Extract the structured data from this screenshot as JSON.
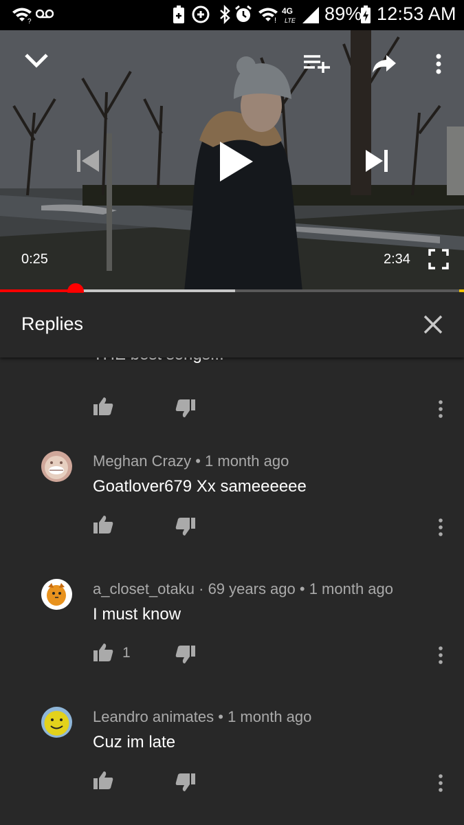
{
  "status_bar": {
    "battery": "89%",
    "time": "12:53 AM",
    "network": "4G LTE",
    "icons": [
      "wifi-icon",
      "voicemail-icon",
      "battery-saver-icon",
      "data-saver-icon",
      "bluetooth-icon",
      "alarm-icon",
      "wifi-signal-icon",
      "network-4g-icon",
      "cell-signal-icon",
      "battery-icon"
    ]
  },
  "player": {
    "current_time": "0:25",
    "duration": "2:34",
    "played_fraction": 0.163,
    "buffered_fraction": 0.507,
    "icons": [
      "collapse-chevron-icon",
      "add-to-playlist-icon",
      "share-icon",
      "more-vert-icon",
      "previous-icon",
      "play-icon",
      "next-icon",
      "fullscreen-icon"
    ]
  },
  "replies": {
    "title": "Replies",
    "close_icon": "close-icon"
  },
  "comments": {
    "partial_text": "THE best songs!!!",
    "items": [
      {
        "author": "Meghan Crazy",
        "time": "1 month ago",
        "text": "Goatlover679 Xx sameeeeee",
        "likes": "",
        "avatar": "face-avatar"
      },
      {
        "author": "a_closet_otaku",
        "extra": "69 years ago",
        "time": "1 month ago",
        "text": "I must know",
        "likes": "1",
        "avatar": "fox-avatar"
      },
      {
        "author": "Leandro animates",
        "time": "1 month ago",
        "text": "Cuz im late",
        "likes": "",
        "avatar": "smiley-avatar"
      }
    ]
  },
  "colors": {
    "background": "#282828",
    "progress_played": "#ff0000",
    "meta_text": "#aaaaaa"
  }
}
